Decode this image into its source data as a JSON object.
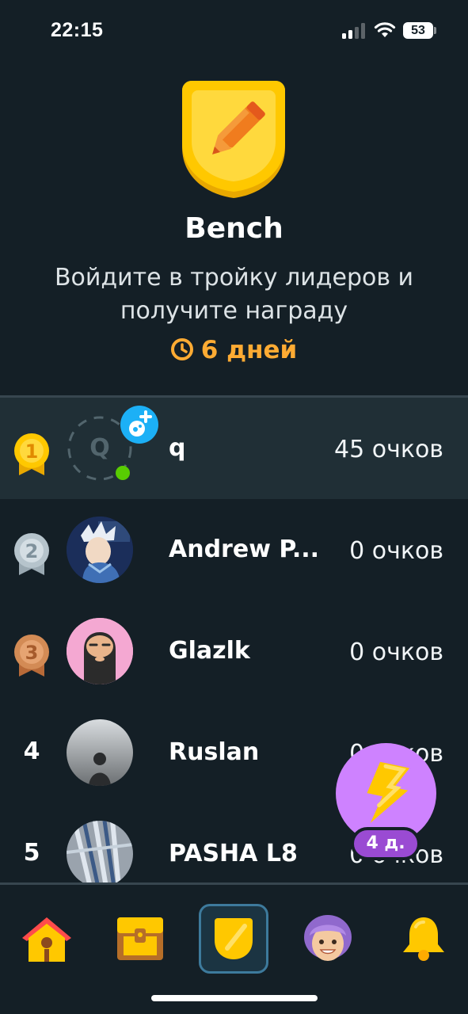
{
  "status": {
    "time": "22:15",
    "battery": "53"
  },
  "league": {
    "name": "Bench",
    "subtitle_line1": "Войдите в тройку лидеров и",
    "subtitle_line2": "получите награду",
    "time_left": "6 дней"
  },
  "leaderboard": [
    {
      "rank": "1",
      "name": "q",
      "points": "45 очков",
      "avatar_letter": "Q",
      "is_me": true
    },
    {
      "rank": "2",
      "name": "Andrew P...",
      "points": "0 очков"
    },
    {
      "rank": "3",
      "name": "Glazlk",
      "points": "0 очков"
    },
    {
      "rank": "4",
      "name": "Ruslan",
      "points": "0 очков"
    },
    {
      "rank": "5",
      "name": "PASHA L8",
      "points": "0 очков"
    }
  ],
  "boost": {
    "label": "4 д."
  },
  "nav": {
    "items": [
      "home-icon",
      "chest-icon",
      "league-shield-icon",
      "profile-avatar-icon",
      "bell-icon"
    ],
    "active": "league-shield-icon"
  },
  "colors": {
    "background": "#141f26",
    "highlight_row": "#202f36",
    "accent_orange": "#ffab33",
    "gold": "#ffc800",
    "boost_purple": "#ce82ff",
    "online_green": "#58cc02"
  }
}
